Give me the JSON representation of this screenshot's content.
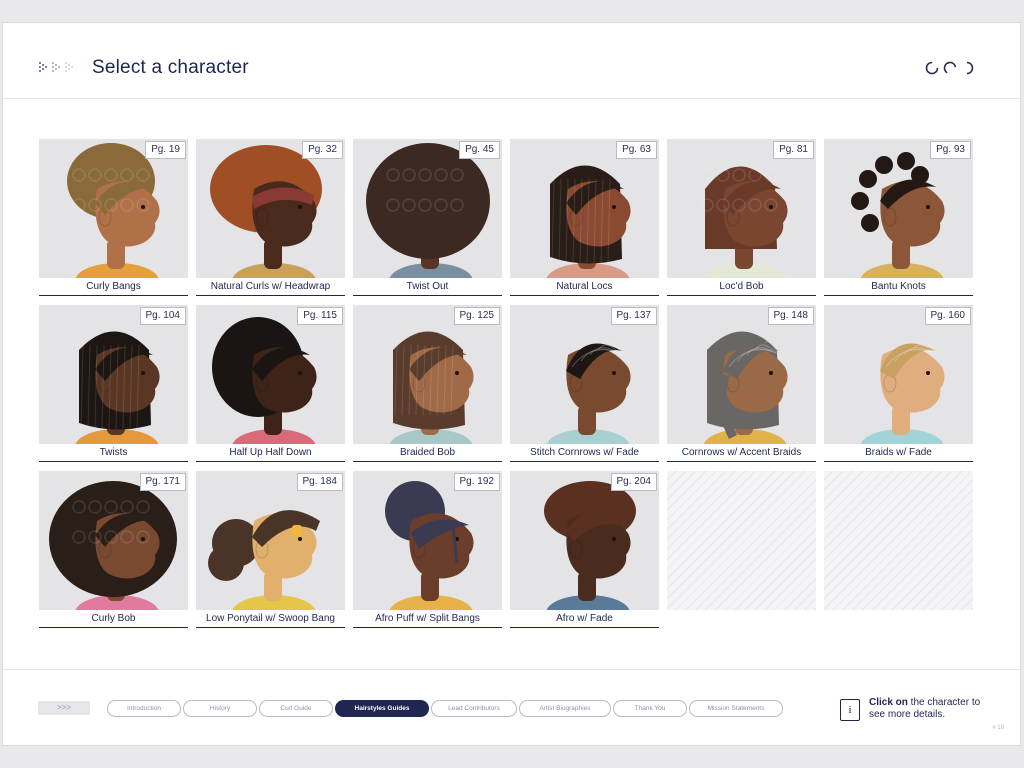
{
  "header": {
    "title": "Select a character"
  },
  "characters": [
    {
      "label": "Curly Bangs",
      "page": "Pg. 19",
      "skin": "#b07048",
      "hair": "#8a6a38",
      "shirt": "#e2a13a",
      "style": "updo"
    },
    {
      "label": "Natural Curls w/ Headwrap",
      "page": "Pg. 32",
      "skin": "#4a2a1c",
      "hair": "#a04e24",
      "shirt": "#c9a15a",
      "style": "headwrap"
    },
    {
      "label": "Twist Out",
      "page": "Pg. 45",
      "skin": "#5a3424",
      "hair": "#3c2a22",
      "shirt": "#7a8fa0",
      "style": "back"
    },
    {
      "label": "Natural Locs",
      "page": "Pg. 63",
      "skin": "#8a4a32",
      "hair": "#2a1d18",
      "shirt": "#d99a86",
      "style": "locs"
    },
    {
      "label": "Loc'd Bob",
      "page": "Pg. 81",
      "skin": "#7a4630",
      "hair": "#6a3a28",
      "shirt": "#e4e8d6",
      "style": "coils"
    },
    {
      "label": "Bantu Knots",
      "page": "Pg. 93",
      "skin": "#8c5638",
      "hair": "#241814",
      "shirt": "#d8b25a",
      "style": "knots"
    },
    {
      "label": "Twists",
      "page": "Pg. 104",
      "skin": "#5a3624",
      "hair": "#1e1612",
      "shirt": "#e49a3c",
      "style": "twists"
    },
    {
      "label": "Half Up Half Down",
      "page": "Pg. 115",
      "skin": "#3e2418",
      "hair": "#1a1412",
      "shirt": "#d96a7a",
      "style": "halfup"
    },
    {
      "label": "Braided Bob",
      "page": "Pg. 125",
      "skin": "#a06a48",
      "hair": "#5a3c2c",
      "shirt": "#a8c8c8",
      "style": "bob"
    },
    {
      "label": "Stitch Cornrows w/ Fade",
      "page": "Pg. 137",
      "skin": "#7a4a30",
      "hair": "#1e1614",
      "shirt": "#a8d0d0",
      "style": "cornrow"
    },
    {
      "label": "Cornrows w/ Accent Braids",
      "page": "Pg. 148",
      "skin": "#9a6a48",
      "hair": "#6a6664",
      "shirt": "#e0b24a",
      "style": "braids"
    },
    {
      "label": "Braids w/ Fade",
      "page": "Pg. 160",
      "skin": "#e0ae7e",
      "hair": "#c8a060",
      "shirt": "#a0d4d6",
      "style": "cornrow"
    },
    {
      "label": "Curly Bob",
      "page": "Pg. 171",
      "skin": "#7a4a30",
      "hair": "#2a1e18",
      "shirt": "#e07aa0",
      "style": "curlybob"
    },
    {
      "label": "Low Ponytail w/ Swoop Bang",
      "page": "Pg. 184",
      "skin": "#e0b06c",
      "hair": "#4a3428",
      "shirt": "#e6c64a",
      "style": "ponytail"
    },
    {
      "label": "Afro Puff w/ Split Bangs",
      "page": "Pg. 192",
      "skin": "#6a3e2a",
      "hair": "#3a3a52",
      "shirt": "#e8b24a",
      "style": "puff"
    },
    {
      "label": "Afro w/ Fade",
      "page": "Pg. 204",
      "skin": "#4a2c1e",
      "hair": "#5a3020",
      "shirt": "#5a7a9a",
      "style": "afro"
    }
  ],
  "footer": {
    "back_label": ">>>",
    "tabs": [
      {
        "label": "Introduction",
        "active": false
      },
      {
        "label": "History",
        "active": false
      },
      {
        "label": "Curl Guide",
        "active": false
      },
      {
        "label": "Hairstyles Guides",
        "active": true
      },
      {
        "label": "Lead Contributors",
        "active": false
      },
      {
        "label": "Artist Biographies",
        "active": false
      },
      {
        "label": "Thank You",
        "active": false
      },
      {
        "label": "Mission Statements",
        "active": false
      }
    ],
    "hint_bold": "Click on",
    "hint_rest": " the character to see more details.",
    "info_icon": "i",
    "page_number": "# 18"
  },
  "colors": {
    "navy": "#1e2550",
    "thumb_bg": "#e4e4e7"
  }
}
